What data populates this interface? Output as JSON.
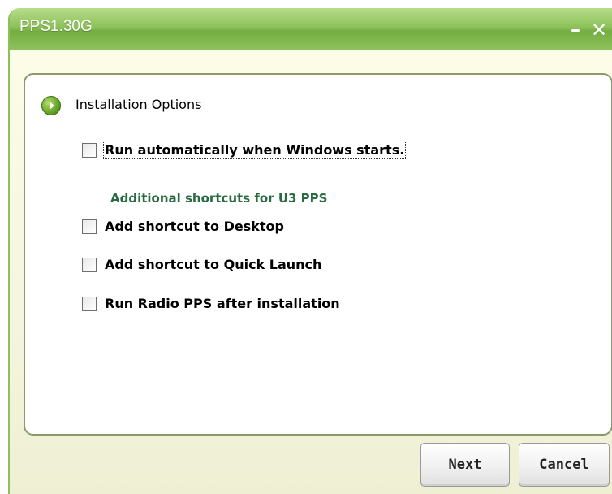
{
  "window": {
    "title": "PPS1.30G",
    "minimize_glyph": "–",
    "close_glyph": "✕"
  },
  "section": {
    "icon": "green-arrow-bullet-icon",
    "title": "Installation Options"
  },
  "options": [
    {
      "label": "Run automatically when Windows starts.",
      "checked": false
    },
    {
      "label": "Add shortcut to Desktop",
      "checked": false
    },
    {
      "label": "Add shortcut to Quick Launch",
      "checked": false
    },
    {
      "label": "Run Radio PPS after installation",
      "checked": false
    }
  ],
  "subheading": "Additional shortcuts for U3 PPS",
  "buttons": {
    "next": "Next",
    "cancel": "Cancel"
  },
  "colors": {
    "titlebar": "#8cc159",
    "subheading": "#2a6b43",
    "panel_border": "#8a9a6a"
  }
}
